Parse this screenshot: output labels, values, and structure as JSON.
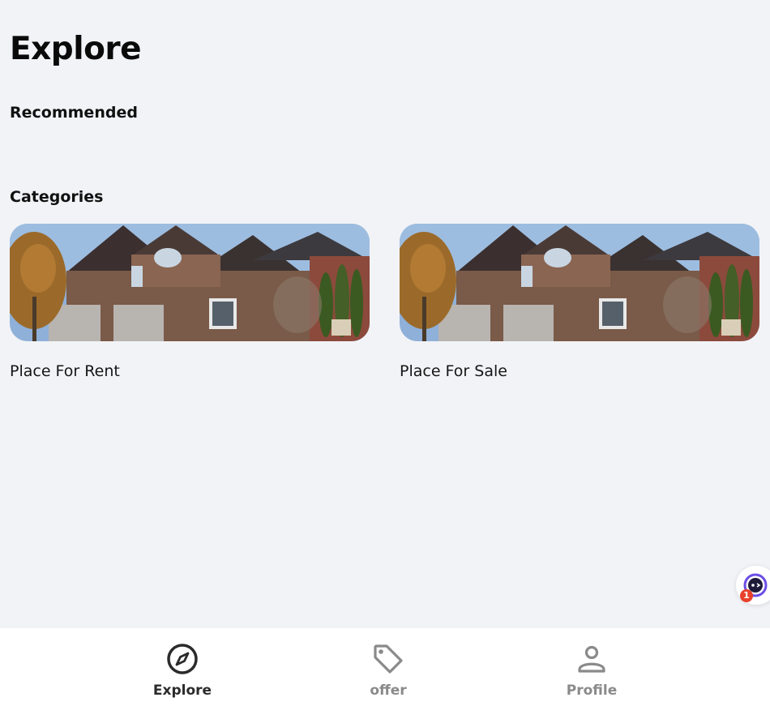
{
  "page": {
    "title": "Explore"
  },
  "sections": {
    "recommended": "Recommended",
    "categories": "Categories"
  },
  "categories": [
    {
      "label": "Place For Rent",
      "image": "house-photo"
    },
    {
      "label": "Place For Sale",
      "image": "house-photo"
    }
  ],
  "assistant": {
    "badge_count": "1",
    "icon": "chat-assistant-icon"
  },
  "bottom_nav": [
    {
      "label": "Explore",
      "icon": "compass-icon",
      "active": true
    },
    {
      "label": "offer",
      "icon": "tag-icon",
      "active": false
    },
    {
      "label": "Profile",
      "icon": "person-icon",
      "active": false
    }
  ],
  "colors": {
    "background": "#f2f3f7",
    "nav_active": "#2b2b2b",
    "nav_inactive": "#8a8a8a",
    "badge": "#e8412c",
    "assistant_accent": "#6b4ee6"
  }
}
